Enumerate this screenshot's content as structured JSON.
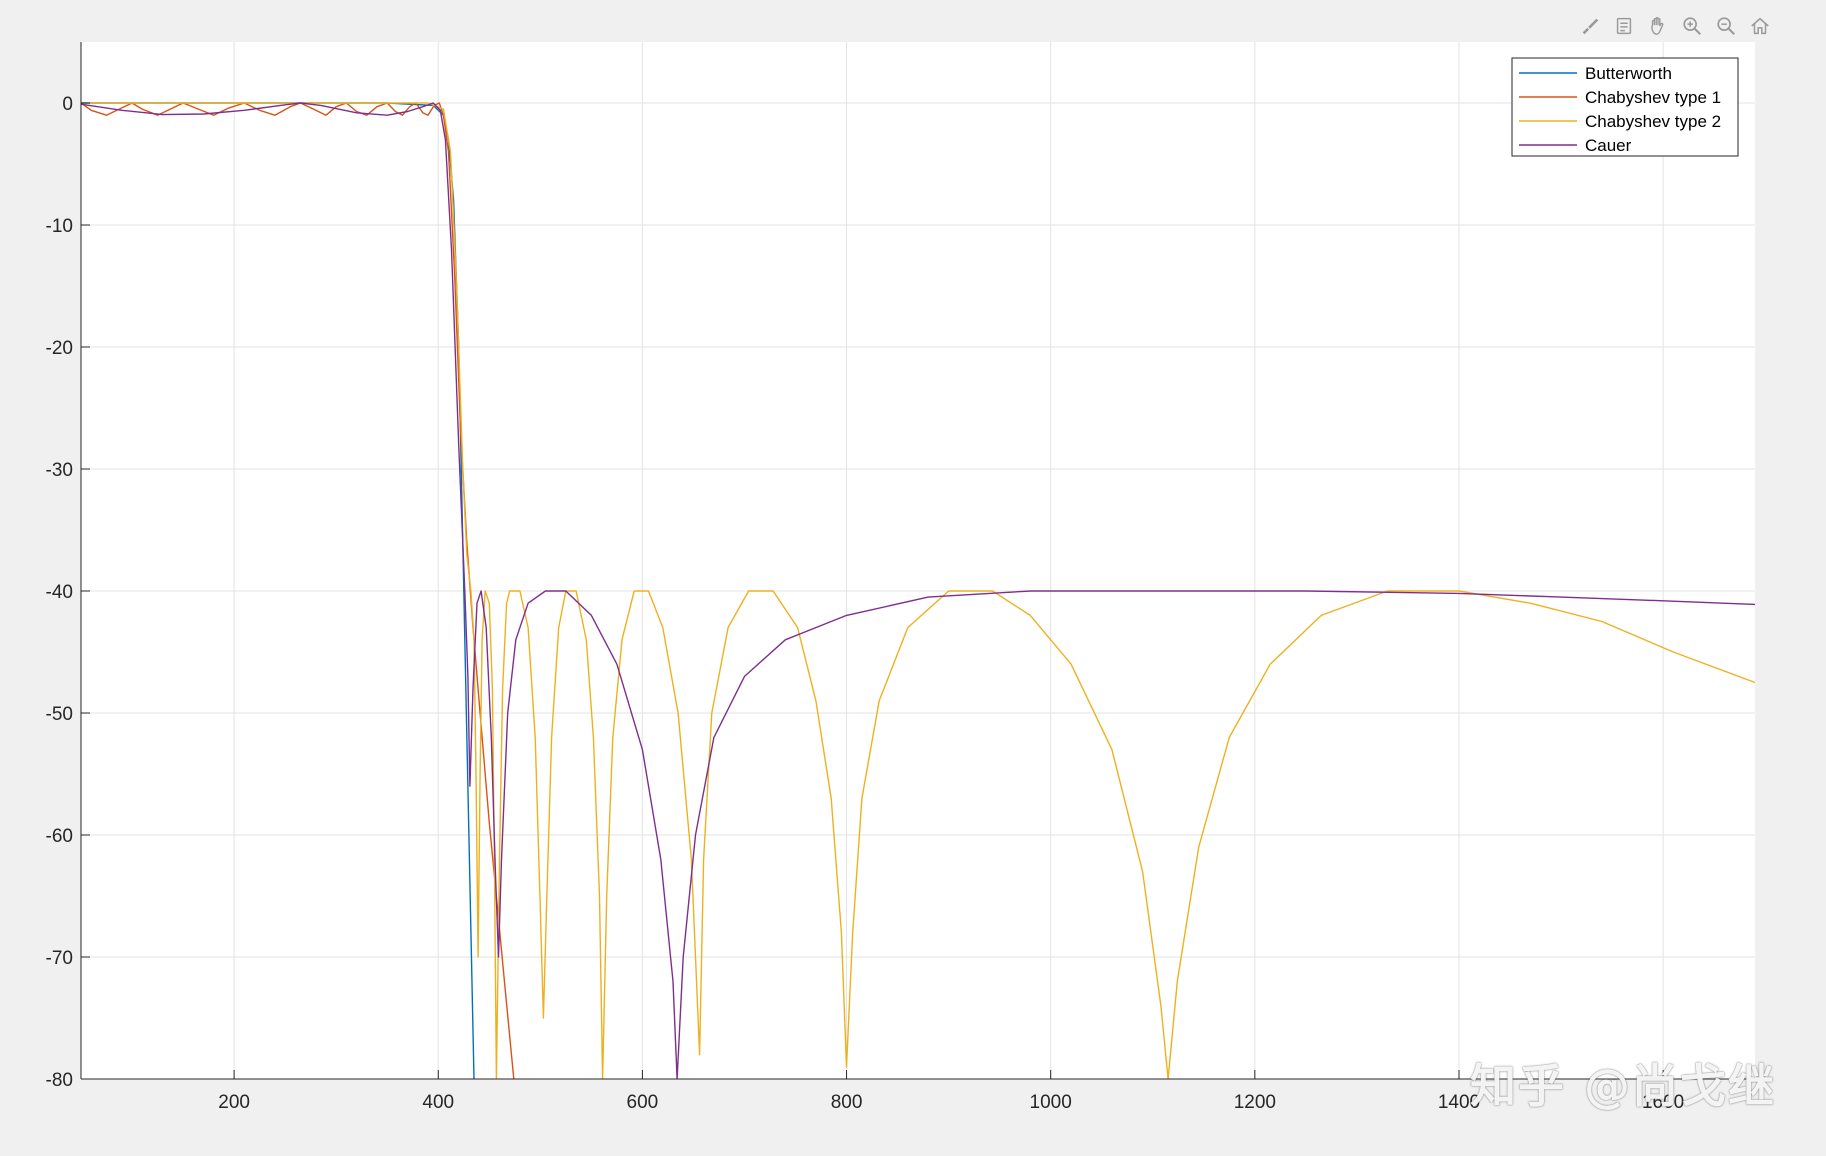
{
  "window": {
    "background": "#f0f0f0"
  },
  "toolbar": {
    "buttons": [
      {
        "name": "brush-icon"
      },
      {
        "name": "data-tips-icon"
      },
      {
        "name": "pan-hand-icon"
      },
      {
        "name": "zoom-in-icon"
      },
      {
        "name": "zoom-out-icon"
      },
      {
        "name": "home-icon"
      }
    ]
  },
  "watermark": {
    "text": "知乎 @尚戈继"
  },
  "chart_data": {
    "type": "line",
    "title": "",
    "xlabel": "",
    "ylabel": "",
    "xlim": [
      50,
      1690
    ],
    "ylim": [
      -80,
      5
    ],
    "xticks": [
      200,
      400,
      600,
      800,
      1000,
      1200,
      1400,
      1600
    ],
    "yticks": [
      0,
      -10,
      -20,
      -30,
      -40,
      -50,
      -60,
      -70,
      -80
    ],
    "grid": true,
    "legend": {
      "placement": "top-right"
    },
    "series": [
      {
        "name": "Butterworth",
        "color": "#0072bd",
        "points": [
          [
            50,
            0
          ],
          [
            150,
            0
          ],
          [
            250,
            0
          ],
          [
            350,
            0
          ],
          [
            395,
            -0.2
          ],
          [
            405,
            -1
          ],
          [
            410,
            -3
          ],
          [
            415,
            -8
          ],
          [
            420,
            -20
          ],
          [
            425,
            -40
          ],
          [
            430,
            -60
          ],
          [
            435,
            -80
          ]
        ]
      },
      {
        "name": "Chabyshev type 1",
        "color": "#d95319",
        "points": [
          [
            50,
            0
          ],
          [
            60,
            -0.6
          ],
          [
            75,
            -1
          ],
          [
            90,
            -0.4
          ],
          [
            100,
            0
          ],
          [
            110,
            -0.5
          ],
          [
            125,
            -1
          ],
          [
            140,
            -0.4
          ],
          [
            150,
            0
          ],
          [
            165,
            -0.5
          ],
          [
            180,
            -1
          ],
          [
            195,
            -0.4
          ],
          [
            210,
            0
          ],
          [
            225,
            -0.6
          ],
          [
            240,
            -1
          ],
          [
            255,
            -0.3
          ],
          [
            265,
            0
          ],
          [
            280,
            -0.6
          ],
          [
            290,
            -1
          ],
          [
            300,
            -0.3
          ],
          [
            310,
            0
          ],
          [
            320,
            -0.7
          ],
          [
            330,
            -1
          ],
          [
            340,
            -0.3
          ],
          [
            350,
            0
          ],
          [
            358,
            -0.7
          ],
          [
            365,
            -1
          ],
          [
            372,
            -0.3
          ],
          [
            378,
            0
          ],
          [
            385,
            -0.8
          ],
          [
            390,
            -1
          ],
          [
            396,
            -0.2
          ],
          [
            401,
            0
          ],
          [
            405,
            -1
          ],
          [
            410,
            -4
          ],
          [
            416,
            -14
          ],
          [
            422,
            -27
          ],
          [
            428,
            -36
          ],
          [
            434,
            -43
          ],
          [
            442,
            -51
          ],
          [
            450,
            -59
          ],
          [
            458,
            -66
          ],
          [
            466,
            -73
          ],
          [
            474,
            -80
          ]
        ]
      },
      {
        "name": "Chabyshev type 2",
        "color": "#edb120",
        "points": [
          [
            50,
            0
          ],
          [
            200,
            0
          ],
          [
            390,
            0
          ],
          [
            405,
            -0.5
          ],
          [
            412,
            -4
          ],
          [
            418,
            -15
          ],
          [
            424,
            -30
          ],
          [
            428,
            -37
          ],
          [
            432,
            -40
          ],
          [
            435,
            -44
          ],
          [
            437,
            -55
          ],
          [
            439,
            -70
          ],
          [
            441,
            -55
          ],
          [
            443,
            -44
          ],
          [
            446,
            -40
          ],
          [
            450,
            -41
          ],
          [
            453,
            -48
          ],
          [
            455,
            -62
          ],
          [
            457,
            -80
          ],
          [
            460,
            -62
          ],
          [
            463,
            -48
          ],
          [
            467,
            -41
          ],
          [
            470,
            -40
          ],
          [
            480,
            -40
          ],
          [
            488,
            -43
          ],
          [
            495,
            -52
          ],
          [
            500,
            -66
          ],
          [
            503,
            -75
          ],
          [
            506,
            -66
          ],
          [
            511,
            -52
          ],
          [
            518,
            -43
          ],
          [
            525,
            -40
          ],
          [
            535,
            -40
          ],
          [
            545,
            -44
          ],
          [
            552,
            -52
          ],
          [
            558,
            -65
          ],
          [
            561,
            -80
          ],
          [
            565,
            -65
          ],
          [
            571,
            -52
          ],
          [
            580,
            -44
          ],
          [
            592,
            -40
          ],
          [
            606,
            -40
          ],
          [
            620,
            -43
          ],
          [
            635,
            -50
          ],
          [
            648,
            -62
          ],
          [
            656,
            -78
          ],
          [
            660,
            -62
          ],
          [
            668,
            -50
          ],
          [
            684,
            -43
          ],
          [
            704,
            -40
          ],
          [
            728,
            -40
          ],
          [
            752,
            -43
          ],
          [
            770,
            -49
          ],
          [
            785,
            -57
          ],
          [
            795,
            -68
          ],
          [
            800,
            -79
          ],
          [
            806,
            -68
          ],
          [
            815,
            -57
          ],
          [
            832,
            -49
          ],
          [
            860,
            -43
          ],
          [
            900,
            -40
          ],
          [
            943,
            -40
          ],
          [
            980,
            -42
          ],
          [
            1020,
            -46
          ],
          [
            1060,
            -53
          ],
          [
            1090,
            -63
          ],
          [
            1108,
            -74
          ],
          [
            1115,
            -80
          ],
          [
            1124,
            -72
          ],
          [
            1145,
            -61
          ],
          [
            1175,
            -52
          ],
          [
            1215,
            -46
          ],
          [
            1265,
            -42
          ],
          [
            1330,
            -40
          ],
          [
            1400,
            -40
          ],
          [
            1470,
            -41
          ],
          [
            1540,
            -42.5
          ],
          [
            1610,
            -45
          ],
          [
            1690,
            -47.5
          ]
        ]
      },
      {
        "name": "Cauer",
        "color": "#7e2f8e",
        "points": [
          [
            50,
            -0.1
          ],
          [
            90,
            -0.6
          ],
          [
            130,
            -0.95
          ],
          [
            170,
            -0.9
          ],
          [
            210,
            -0.6
          ],
          [
            250,
            -0.15
          ],
          [
            265,
            0
          ],
          [
            285,
            -0.2
          ],
          [
            320,
            -0.8
          ],
          [
            350,
            -1
          ],
          [
            370,
            -0.7
          ],
          [
            385,
            -0.3
          ],
          [
            395,
            0
          ],
          [
            402,
            -0.6
          ],
          [
            407,
            -3
          ],
          [
            413,
            -12
          ],
          [
            420,
            -28
          ],
          [
            426,
            -40
          ],
          [
            429,
            -47
          ],
          [
            431,
            -56
          ],
          [
            434,
            -48
          ],
          [
            438,
            -41
          ],
          [
            442,
            -40
          ],
          [
            447,
            -43
          ],
          [
            452,
            -52
          ],
          [
            456,
            -63
          ],
          [
            459,
            -70
          ],
          [
            462,
            -62
          ],
          [
            468,
            -50
          ],
          [
            476,
            -44
          ],
          [
            488,
            -41
          ],
          [
            505,
            -40
          ],
          [
            525,
            -40
          ],
          [
            550,
            -42
          ],
          [
            575,
            -46
          ],
          [
            600,
            -53
          ],
          [
            618,
            -62
          ],
          [
            630,
            -72
          ],
          [
            634,
            -80
          ],
          [
            640,
            -70
          ],
          [
            652,
            -60
          ],
          [
            670,
            -52
          ],
          [
            700,
            -47
          ],
          [
            740,
            -44
          ],
          [
            800,
            -42
          ],
          [
            880,
            -40.5
          ],
          [
            980,
            -40
          ],
          [
            1100,
            -40
          ],
          [
            1250,
            -40
          ],
          [
            1400,
            -40.2
          ],
          [
            1500,
            -40.5
          ],
          [
            1600,
            -40.8
          ],
          [
            1690,
            -41.1
          ]
        ]
      }
    ]
  }
}
